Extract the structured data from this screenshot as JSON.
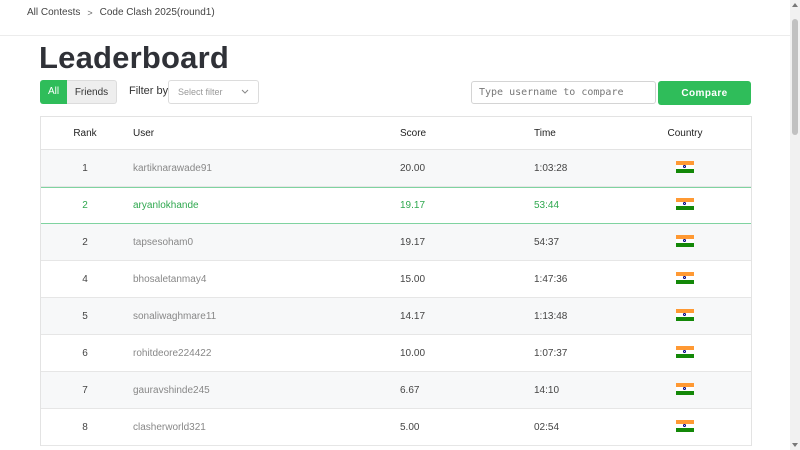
{
  "breadcrumb": {
    "items": [
      "All Contests",
      "Code Clash 2025(round1)"
    ],
    "separator": ">"
  },
  "page_title": "Leaderboard",
  "controls": {
    "all_label": "All",
    "friends_label": "Friends",
    "filter_label": "Filter by",
    "filter_placeholder": "Select filter",
    "compare_placeholder": "Type username to compare",
    "compare_label": "Compare"
  },
  "table": {
    "headers": {
      "rank": "Rank",
      "user": "User",
      "score": "Score",
      "time": "Time",
      "country": "Country"
    },
    "rows": [
      {
        "rank": "1",
        "user": "kartiknarawade91",
        "score": "20.00",
        "time": "1:03:28",
        "country_icon": "india-flag-icon",
        "highlight": false
      },
      {
        "rank": "2",
        "user": "aryanlokhande",
        "score": "19.17",
        "time": "53:44",
        "country_icon": "india-flag-icon",
        "highlight": true
      },
      {
        "rank": "2",
        "user": "tapsesoham0",
        "score": "19.17",
        "time": "54:37",
        "country_icon": "india-flag-icon",
        "highlight": false
      },
      {
        "rank": "4",
        "user": "bhosaletanmay4",
        "score": "15.00",
        "time": "1:47:36",
        "country_icon": "india-flag-icon",
        "highlight": false
      },
      {
        "rank": "5",
        "user": "sonaliwaghmare11",
        "score": "14.17",
        "time": "1:13:48",
        "country_icon": "india-flag-icon",
        "highlight": false
      },
      {
        "rank": "6",
        "user": "rohitdeore224422",
        "score": "10.00",
        "time": "1:07:37",
        "country_icon": "india-flag-icon",
        "highlight": false
      },
      {
        "rank": "7",
        "user": "gauravshinde245",
        "score": "6.67",
        "time": "14:10",
        "country_icon": "india-flag-icon",
        "highlight": false
      },
      {
        "rank": "8",
        "user": "clasherworld321",
        "score": "5.00",
        "time": "02:54",
        "country_icon": "india-flag-icon",
        "highlight": false
      }
    ]
  },
  "colors": {
    "accent": "#2fbd5a",
    "highlight_text": "#2fa84f",
    "highlight_border": "#7fd3a0",
    "title": "#2f3137"
  }
}
